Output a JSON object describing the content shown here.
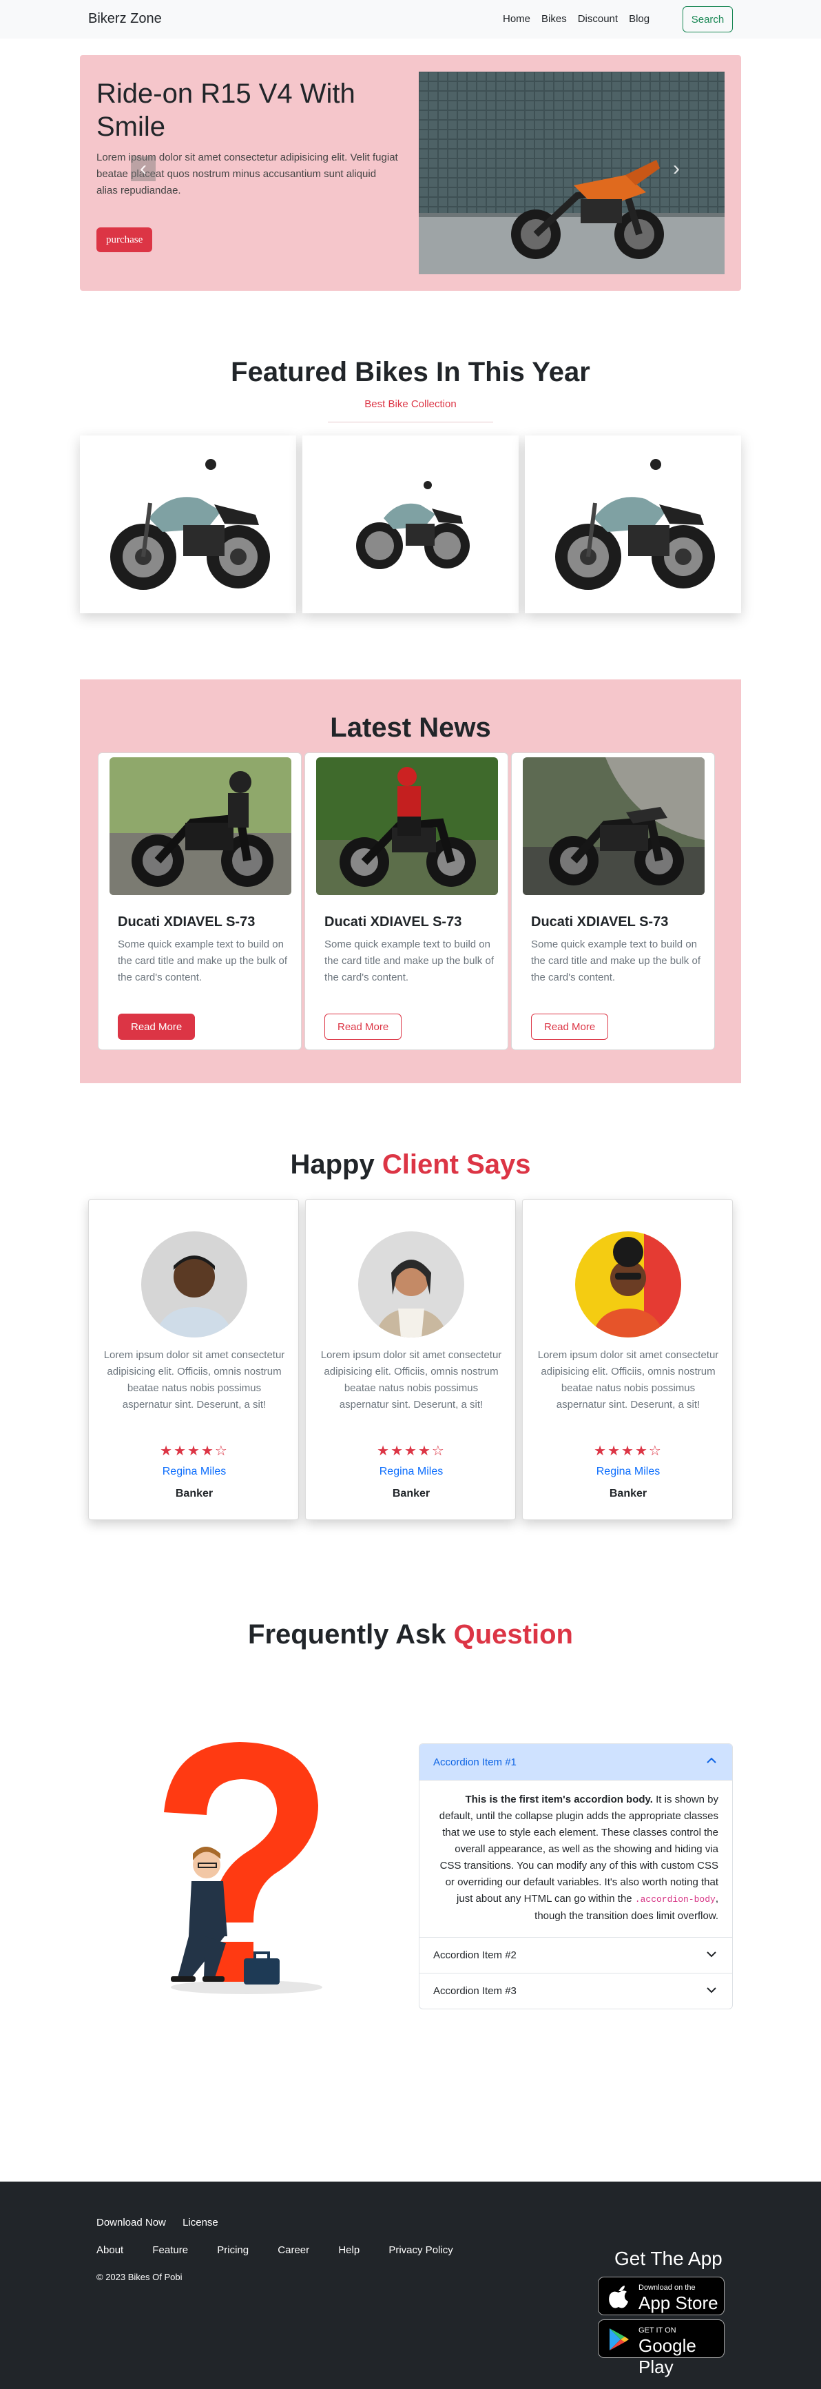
{
  "nav": {
    "brand": "Bikerz Zone",
    "links": [
      "Home",
      "Bikes",
      "Discount",
      "Blog"
    ],
    "search_label": "Search"
  },
  "hero": {
    "title": "Ride-on R15 V4 With Smile",
    "text": "Lorem ipsum dolor sit amet consectetur adipisicing elit. Velit fugiat beatae placeat quos nostrum minus accusantium sunt aliquid alias repudiandae.",
    "button": "purchase",
    "prev_icon": "chevron-left-icon",
    "next_icon": "chevron-right-icon"
  },
  "featured": {
    "title": "Featured Bikes In This Year",
    "subtitle": "Best Bike Collection"
  },
  "news": {
    "title": "Latest News",
    "cards": [
      {
        "title": "Ducati XDIAVEL S-73",
        "text": "Some quick example text to build on the card title and make up the bulk of the card's content.",
        "button": "Read More"
      },
      {
        "title": "Ducati XDIAVEL S-73",
        "text": "Some quick example text to build on the card title and make up the bulk of the card's content.",
        "button": "Read More"
      },
      {
        "title": "Ducati XDIAVEL S-73",
        "text": "Some quick example text to build on the card title and make up the bulk of the card's content.",
        "button": "Read More"
      }
    ]
  },
  "clients": {
    "title_a": "Happy",
    "title_b": "Client Says",
    "cards": [
      {
        "text": "Lorem ipsum dolor sit amet consectetur adipisicing elit. Officiis, omnis nostrum beatae natus nobis possimus aspernatur sint. Deserunt, a sit!",
        "stars": "★★★★☆",
        "rating": 4,
        "name": "Regina Miles",
        "job": "Banker"
      },
      {
        "text": "Lorem ipsum dolor sit amet consectetur adipisicing elit. Officiis, omnis nostrum beatae natus nobis possimus aspernatur sint. Deserunt, a sit!",
        "stars": "★★★★☆",
        "rating": 4,
        "name": "Regina Miles",
        "job": "Banker"
      },
      {
        "text": "Lorem ipsum dolor sit amet consectetur adipisicing elit. Officiis, omnis nostrum beatae natus nobis possimus aspernatur sint. Deserunt, a sit!",
        "stars": "★★★★☆",
        "rating": 4,
        "name": "Regina Miles",
        "job": "Banker"
      }
    ]
  },
  "faq": {
    "title_a": "Frequently Ask",
    "title_b": "Question",
    "items": [
      {
        "label": "Accordion Item #1",
        "expanded": true
      },
      {
        "label": "Accordion Item #2",
        "expanded": false
      },
      {
        "label": "Accordion Item #3",
        "expanded": false
      }
    ],
    "body_strong": "This is the first item's accordion body.",
    "body_text": " It is shown by default, until the collapse plugin adds the appropriate classes that we use to style each element. These classes control the overall appearance, as well as the showing and hiding via CSS transitions. You can modify any of this with custom CSS or overriding our default variables. It's also worth noting that just about any HTML can go within the ",
    "body_code": ".accordion-body",
    "body_end": ", though the transition does limit overflow."
  },
  "footer": {
    "row1": [
      "Download Now",
      "License"
    ],
    "row2": [
      "About",
      "Feature",
      "Pricing",
      "Career",
      "Help",
      "Privacy Policy"
    ],
    "copyright": "© 2023 Bikes Of Pobi",
    "app_title": "Get The App",
    "appstore_small": "Download on the",
    "appstore_big": "App Store",
    "googleplay_small": "GET IT ON",
    "googleplay_big": "Google Play"
  },
  "colors": {
    "accent": "#dc3545",
    "hero_bg": "#f5c6cb",
    "success": "#198754",
    "link": "#0d6efd",
    "footer_bg": "#212529",
    "accordion_active": "#cfe2ff"
  }
}
